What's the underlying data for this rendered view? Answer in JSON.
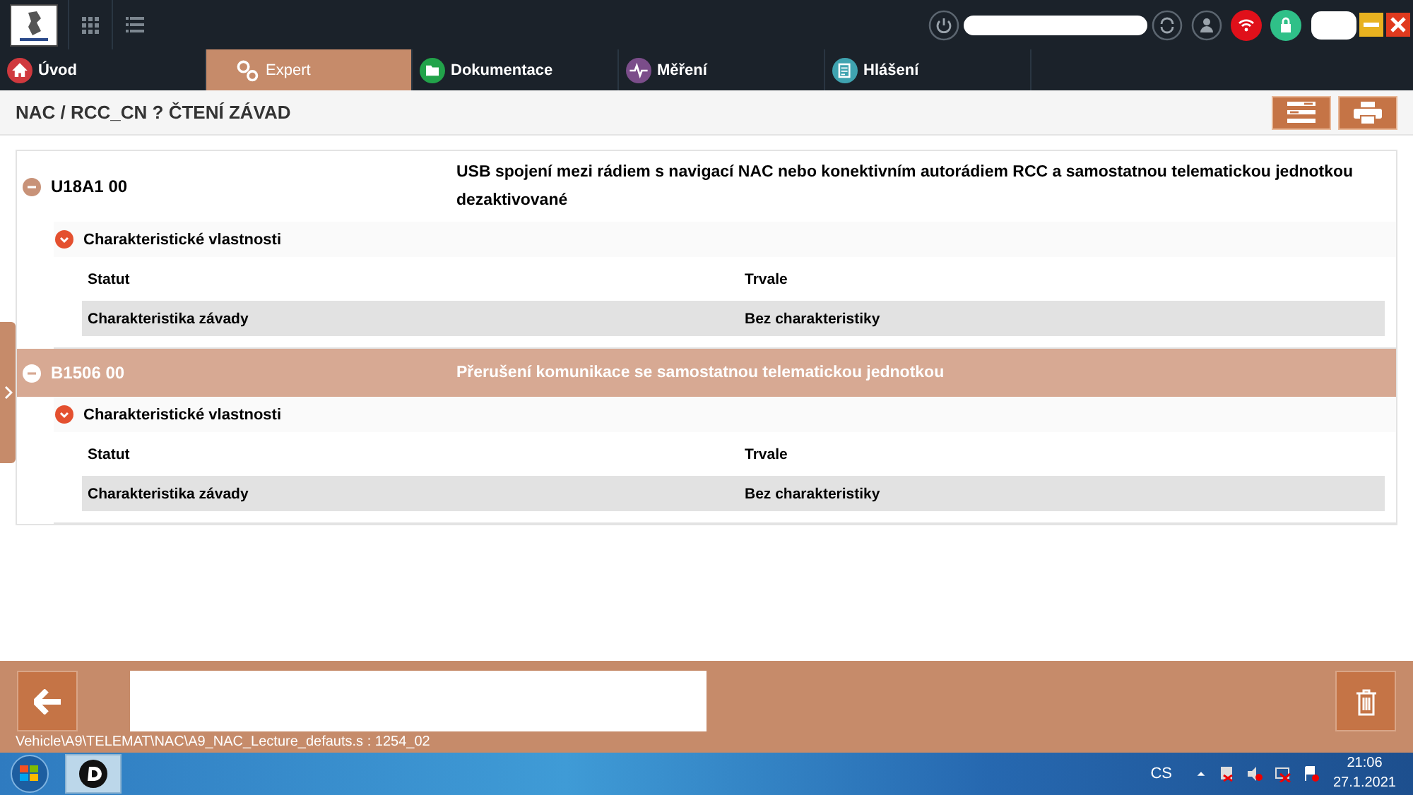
{
  "tabs": [
    {
      "label": "Úvod",
      "selected": false
    },
    {
      "label": "Expert",
      "selected": true
    },
    {
      "label": "Dokumentace",
      "selected": false
    },
    {
      "label": "Měření",
      "selected": false
    },
    {
      "label": "Hlášení",
      "selected": false
    }
  ],
  "page_title": "NAC / RCC_CN ? ČTENÍ ZÁVAD",
  "faults": [
    {
      "code": "U18A1 00",
      "description": "USB spojení mezi rádiem s navigací NAC nebo konektivním autorádiem RCC a samostatnou telematickou jednotkou dezaktivované",
      "selected": false,
      "expanded": true,
      "section": {
        "title": "Charakteristické vlastnosti",
        "expanded": true,
        "header": [
          "Statut",
          "Trvale"
        ],
        "row": [
          "Charakteristika závady",
          "Bez charakteristiky"
        ]
      }
    },
    {
      "code": "B1506 00",
      "description": "Přerušení komunikace se samostatnou telematickou jednotkou",
      "selected": true,
      "expanded": true,
      "section": {
        "title": "Charakteristické vlastnosti",
        "expanded": true,
        "header": [
          "Statut",
          "Trvale"
        ],
        "row": [
          "Charakteristika závady",
          "Bez charakteristiky"
        ]
      }
    }
  ],
  "script_path": "Vehicle\\A9\\TELEMAT\\NAC\\A9_NAC_Lecture_defauts.s : 1254_02",
  "taskbar": {
    "language": "CS",
    "time": "21:06",
    "date": "27.1.2021"
  }
}
